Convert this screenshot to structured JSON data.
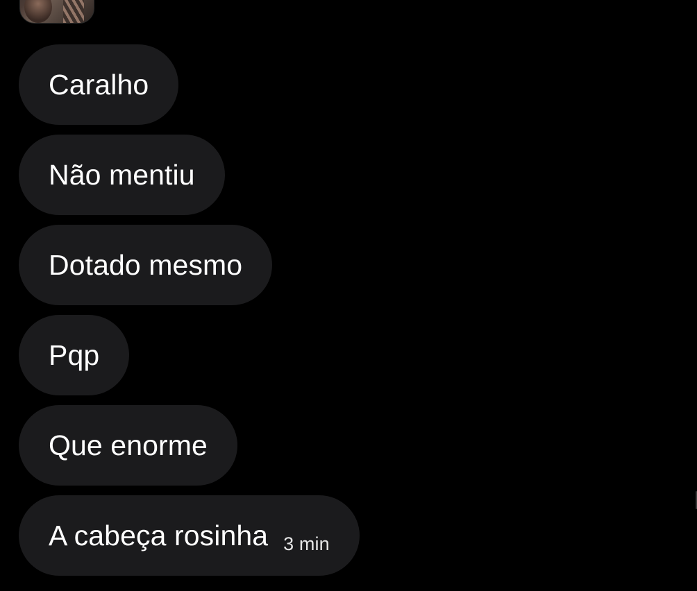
{
  "conversation": {
    "avatar_icon": "user-avatar",
    "messages": [
      {
        "text": "Caralho"
      },
      {
        "text": "Não mentiu"
      },
      {
        "text": "Dotado mesmo"
      },
      {
        "text": "Pqp"
      },
      {
        "text": "Que enorme"
      },
      {
        "text": "A cabeça rosinha",
        "timestamp": "3 min"
      }
    ]
  },
  "colors": {
    "background": "#000000",
    "bubble": "#1b1b1d",
    "text": "#ffffff"
  }
}
